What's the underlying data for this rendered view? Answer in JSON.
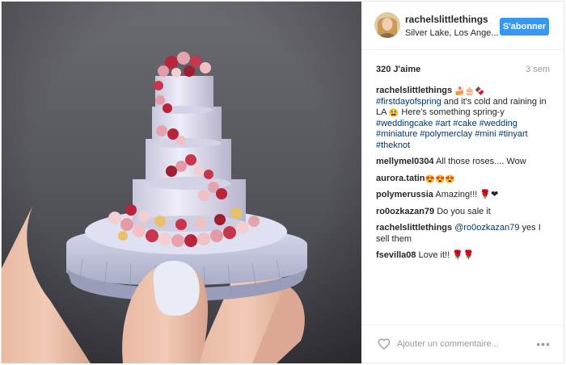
{
  "post": {
    "username": "rachelslittlethings",
    "location": "Silver Lake, Los Ange...",
    "follow_label": "S'abonner",
    "likes": "320 J'aime",
    "time_ago": "3 sem"
  },
  "caption": {
    "user": "rachelslittlethings",
    "emojis": "🍰🎂🍫",
    "tags_1": "#firstdayofspring",
    "text_1": " and it's cold and raining in LA ",
    "emoji_2": "😫",
    "text_2": " Here's something spring-y ",
    "tags_2": "#weddingcake #art #cake #wedding #miniature #polymerclay #mini #tinyart #theknot"
  },
  "comments": [
    {
      "user": "mellymel0304",
      "text": " All those roses.... Wow"
    },
    {
      "user": "aurora.tatin",
      "text": " 😍😍😍"
    },
    {
      "user": "polymerussia",
      "text": " Amazing!!! 🌹❤"
    },
    {
      "user": "ro0ozkazan79",
      "text": " Do you sale it"
    },
    {
      "user": "rachelslittlethings",
      "mention": " @ro0ozkazan79",
      "text": " yes I sell them"
    },
    {
      "user": "fsevilla08",
      "text": " Love it!! 🌹🌹"
    }
  ],
  "footer": {
    "add_comment_placeholder": "Ajouter un commentaire...",
    "more_icon": "•••"
  },
  "icons": {
    "heart": "heart-icon",
    "more": "more-options-icon",
    "avatar": "avatar"
  },
  "colors": {
    "follow_button": "#3897f0",
    "hashtag": "#003569",
    "muted": "#999999"
  }
}
